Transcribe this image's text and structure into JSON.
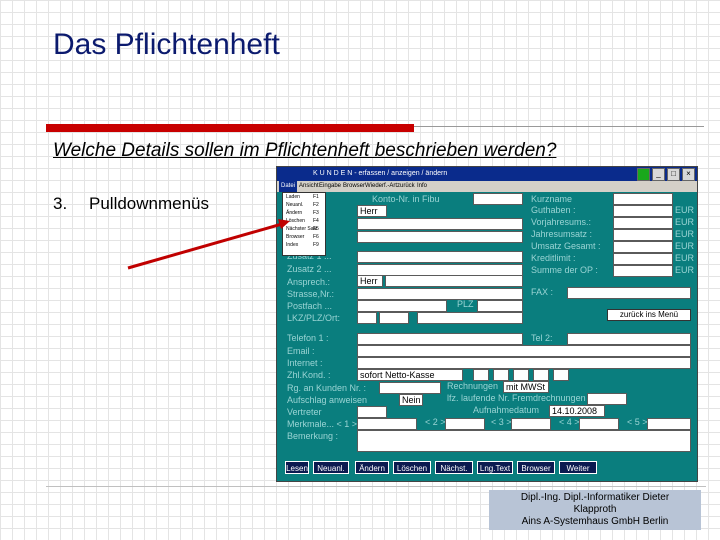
{
  "slide": {
    "title": "Das Pflichtenheft",
    "subtitle": "Welche Details sollen im Pflichtenheft beschrieben werden?",
    "item_number": "3.",
    "item_text": "Pulldownmenüs",
    "footer_line1": "Dipl.-Ing. Dipl.-Informatiker Dieter",
    "footer_line2": "Klapproth",
    "footer_line3": "Ains A-Systemhaus GmbH  Berlin"
  },
  "screenshot": {
    "window_title": "K U N D E N   - erfassen / anzeigen / ändern",
    "menu": [
      "Datei",
      "Ansicht",
      "Eingabe",
      "Browser",
      "Wiederf.-Art",
      "zurück",
      "Info"
    ],
    "dropdown": [
      {
        "label": "Laden",
        "key": "F1"
      },
      {
        "label": "Neuanl.",
        "key": "F2"
      },
      {
        "label": "Ändern",
        "key": "F3"
      },
      {
        "label": "Löschen",
        "key": "F4"
      },
      {
        "label": "Nächster Satz",
        "key": "F5"
      },
      {
        "label": "Browser",
        "key": "F6"
      },
      {
        "label": "Index",
        "key": "F9"
      }
    ],
    "labels": {
      "konto": "Konto-Nr. in Fibu",
      "kurzname": "Kurzname",
      "guthaben": "Guthaben :",
      "vorjahresums": "Vorjahresums.:",
      "jahresumsatz": "Jahresumsatz :",
      "umsatz_gesamt": "Umsatz Gesamt :",
      "kreditlimit": "Kreditlimit :",
      "summe_op": "Summe der OP :",
      "zusatz1": "Zusatz 1 ...",
      "zusatz2": "Zusatz 2 ...",
      "ansprech": "Ansprech.:",
      "strasse": "Strasse,Nr.:",
      "postfach": "Postfach ...",
      "lkz": "LKZ/PLZ/Ort:",
      "plz": "PLZ",
      "fax": "FAX :",
      "telefon": "Telefon 1 :",
      "telefon2": "Tel 2:",
      "email": "Email :",
      "internet": "Internet :",
      "zahl": "Zhl.Kond. :",
      "rg": "Rg. an Kunden Nr. :",
      "rechnungen": "Rechnungen",
      "aufschlag": "Aufschlag anweisen",
      "lfd": "lfz. laufende Nr. Fremdrechnungen",
      "vertreter": "Vertreter",
      "aufnahmedatum": "Aufnahmedatum",
      "merkmale": "Merkmale... < 1 >",
      "bemerkung": "Bemerkung :",
      "m2": "< 2 >",
      "m3": "< 3 >",
      "m4": "< 4 >",
      "m5": "< 5 >"
    },
    "currency": "EUR",
    "values": {
      "anrede": "Herr",
      "ansprech_anrede": "Herr",
      "zahlungskondition": "sofort Netto-Kasse",
      "rechnungen_val": "mit MWSt",
      "aufschlag_val": "Nein",
      "datum": "14.10.2008"
    },
    "zurueck_button": "zurück ins Menü",
    "buttons": [
      "Lesen",
      "Neuanl.",
      "Ändern",
      "Löschen",
      "Nächst.",
      "Lng.Text",
      "Browser",
      "Weiter"
    ]
  }
}
